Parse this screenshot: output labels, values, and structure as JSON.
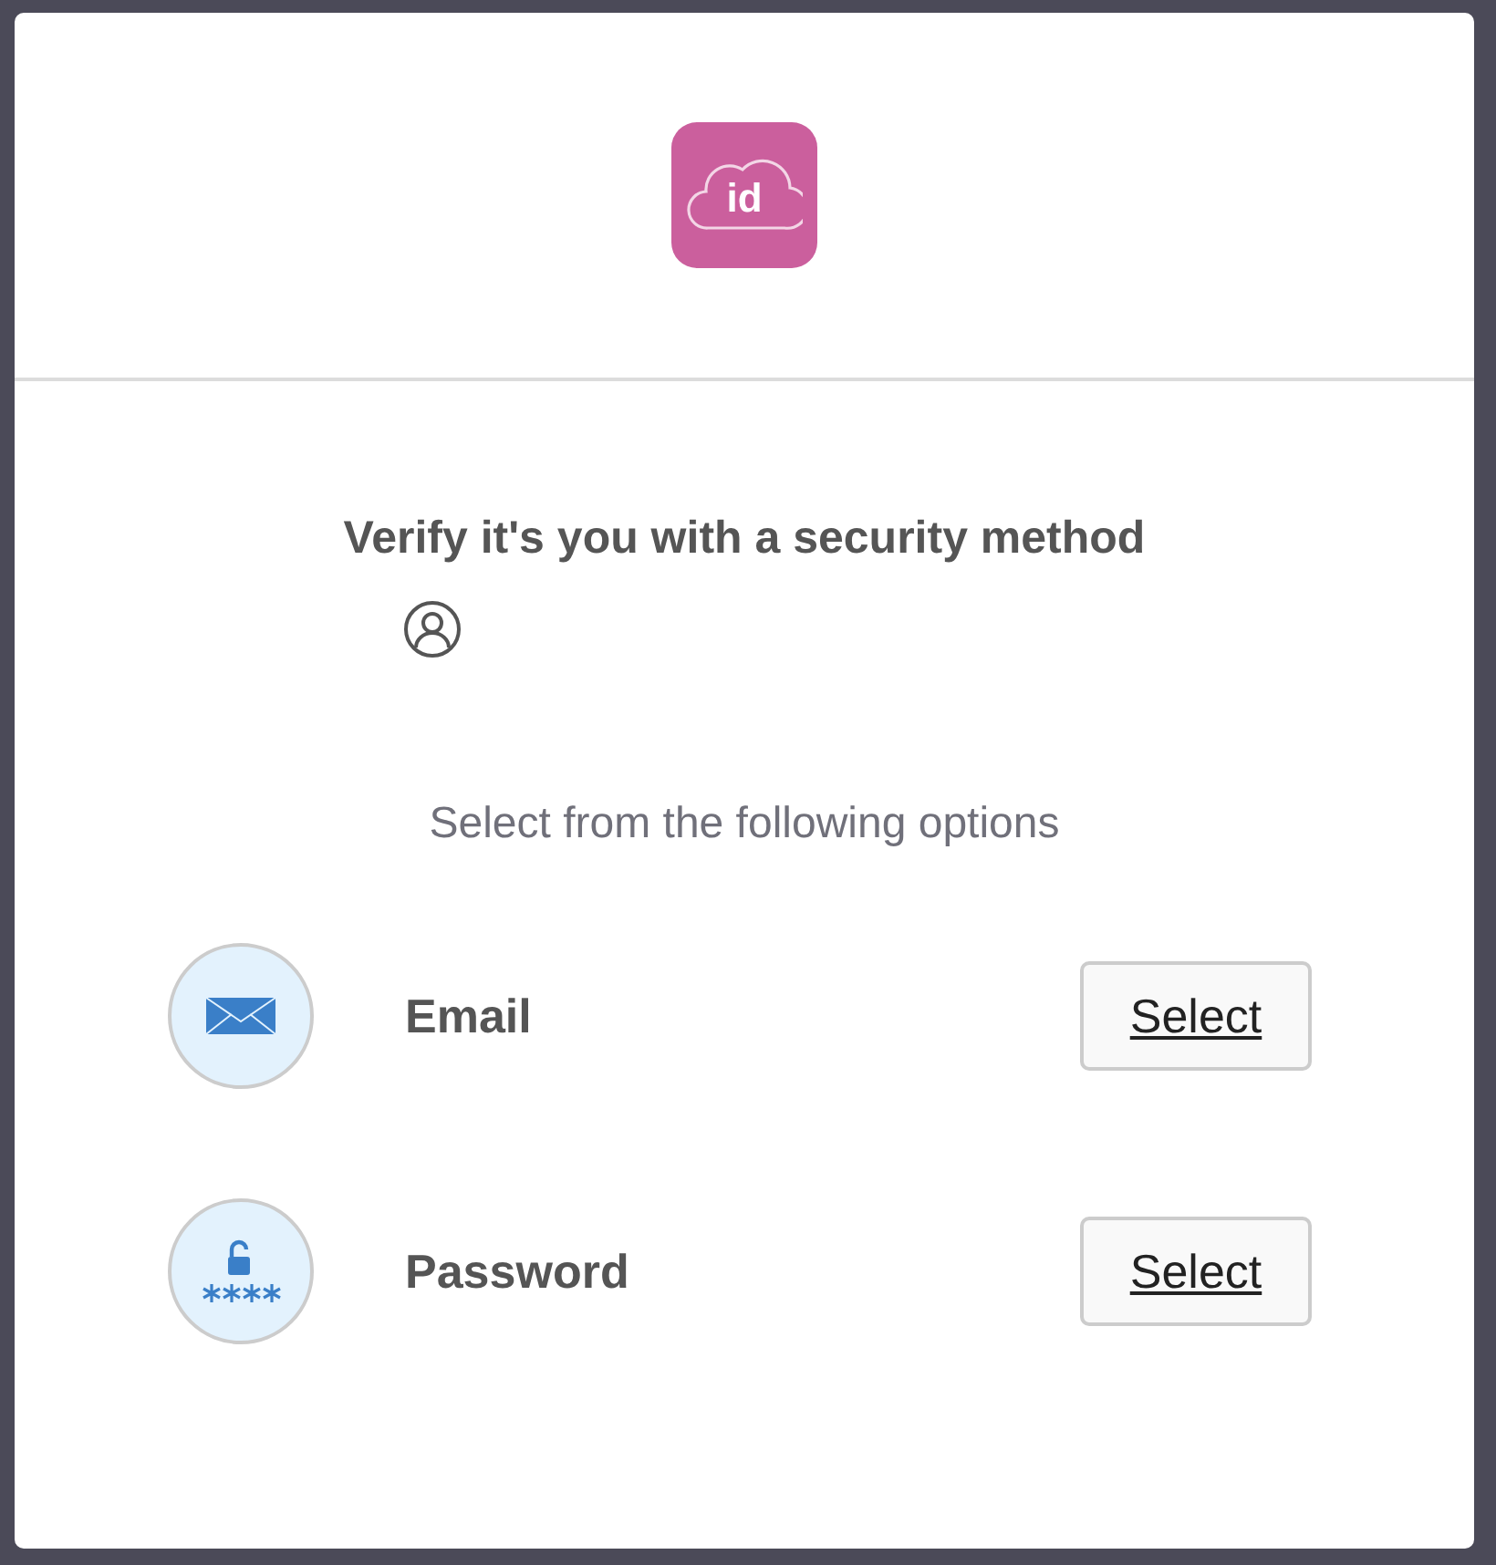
{
  "logo": {
    "text": "id"
  },
  "title": "Verify it's you with a security method",
  "subtitle": "Select from the following options",
  "methods": [
    {
      "kind": "email",
      "label": "Email",
      "button": "Select"
    },
    {
      "kind": "password",
      "label": "Password",
      "button": "Select"
    }
  ]
}
